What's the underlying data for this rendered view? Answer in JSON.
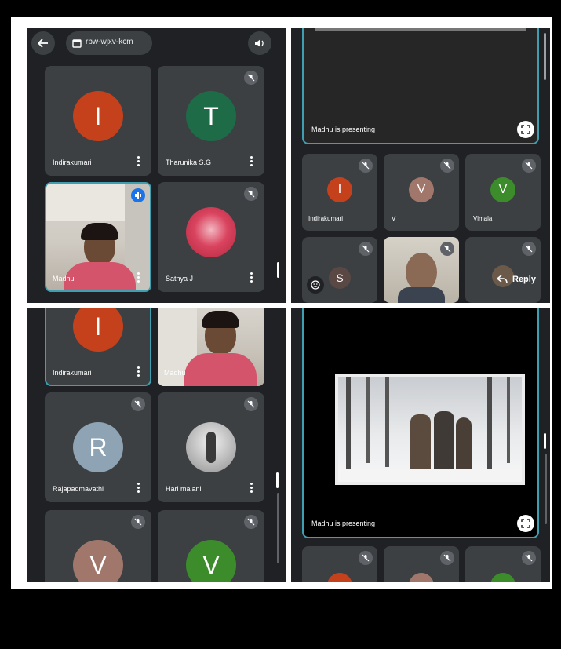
{
  "top_left": {
    "meeting_code": "rbw-wjxv-kcm",
    "tiles": [
      {
        "name": "Indirakumari",
        "initial": "I",
        "color": "#c5411c"
      },
      {
        "name": "Tharunika S.G",
        "initial": "T",
        "color": "#1e6b48"
      },
      {
        "name": "Madhu",
        "initial": ""
      },
      {
        "name": "Sathya J",
        "initial": ""
      }
    ]
  },
  "top_right": {
    "presenting_text": "Madhu is presenting",
    "tiles": [
      {
        "name": "Indirakumari",
        "initial": "I",
        "color": "#c5411c"
      },
      {
        "name": "V",
        "initial": "V",
        "color": "#a1776b"
      },
      {
        "name": "Vimala",
        "initial": "V",
        "color": "#3c8c2c"
      },
      {
        "name": "",
        "initial": "S",
        "color": "#5a4844"
      }
    ],
    "reply_label": "Reply"
  },
  "bottom_left": {
    "tiles": [
      {
        "name": "Indirakumari",
        "initial": "I",
        "color": "#c5411c"
      },
      {
        "name": "Madhu",
        "initial": ""
      },
      {
        "name": "Rajapadmavathi",
        "initial": "R",
        "color": "#8ea3b3"
      },
      {
        "name": "Hari malani",
        "initial": ""
      },
      {
        "name": "",
        "initial": "V",
        "color": "#a1776b"
      },
      {
        "name": "",
        "initial": "V",
        "color": "#3c8c2c"
      }
    ]
  },
  "bottom_right": {
    "presenting_text": "Madhu is presenting"
  },
  "colors": {
    "bg": "#1f2125",
    "tile": "#3c4043",
    "accent": "#1a73e8"
  }
}
